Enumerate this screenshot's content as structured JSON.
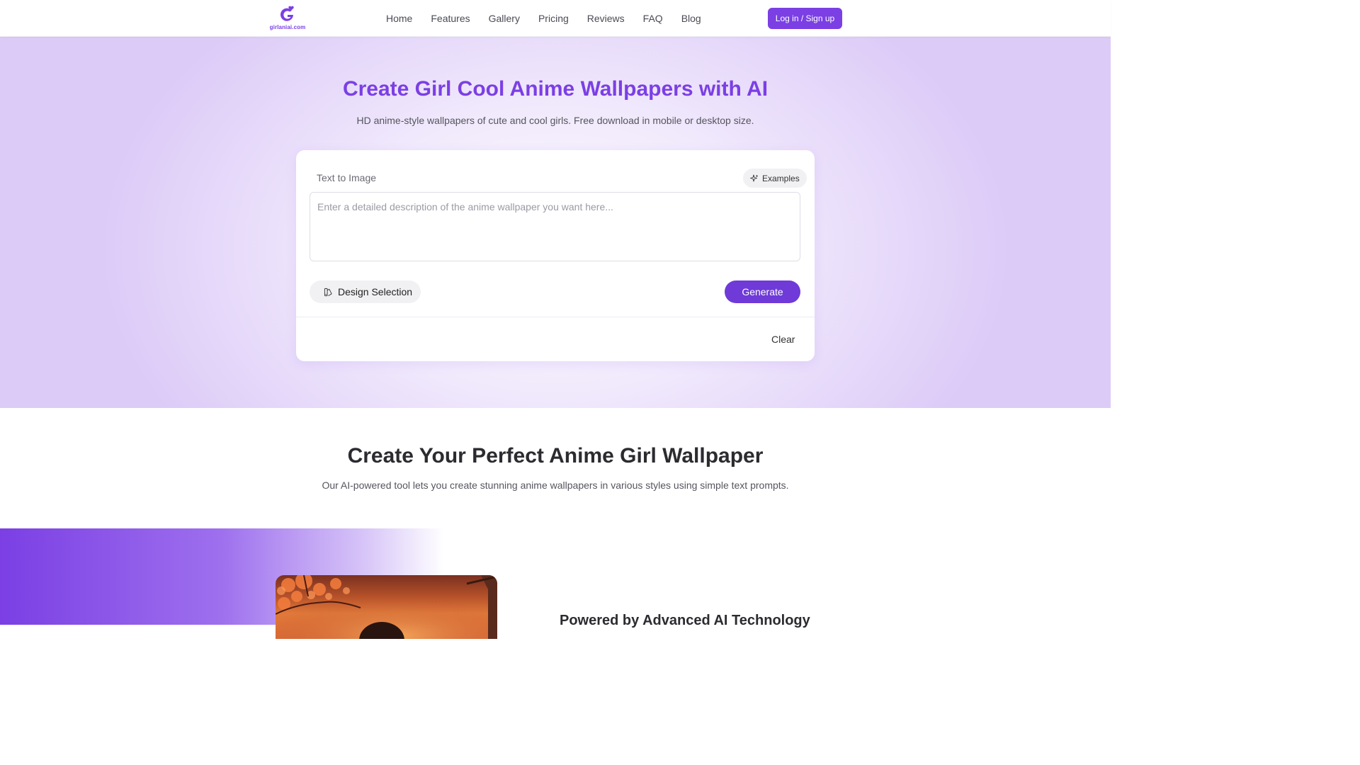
{
  "header": {
    "logo_text": "girlaniai.com",
    "nav": [
      "Home",
      "Features",
      "Gallery",
      "Pricing",
      "Reviews",
      "FAQ",
      "Blog"
    ],
    "login_label": "Log in / Sign up"
  },
  "hero": {
    "title": "Create Girl Cool Anime Wallpapers with AI",
    "subtitle": "HD anime-style wallpapers of cute and cool girls. Free download in mobile or desktop size."
  },
  "generator": {
    "mode_label": "Text to Image",
    "examples_label": "Examples",
    "prompt_value": "",
    "prompt_placeholder": "Enter a detailed description of the anime wallpaper you want here...",
    "design_label": "Design Selection",
    "generate_label": "Generate",
    "clear_label": "Clear"
  },
  "section": {
    "title": "Create Your Perfect Anime Girl Wallpaper",
    "subtitle": "Our AI-powered tool lets you create stunning anime wallpapers in various styles using simple text prompts."
  },
  "feature": {
    "heading": "Powered by Advanced AI Technology"
  },
  "colors": {
    "accent": "#7b3fe4",
    "generate": "#6f3ad8"
  },
  "icons": {
    "logo": "girlaniai-logo-icon",
    "examples": "sparkles-icon",
    "design": "palette-icon"
  }
}
